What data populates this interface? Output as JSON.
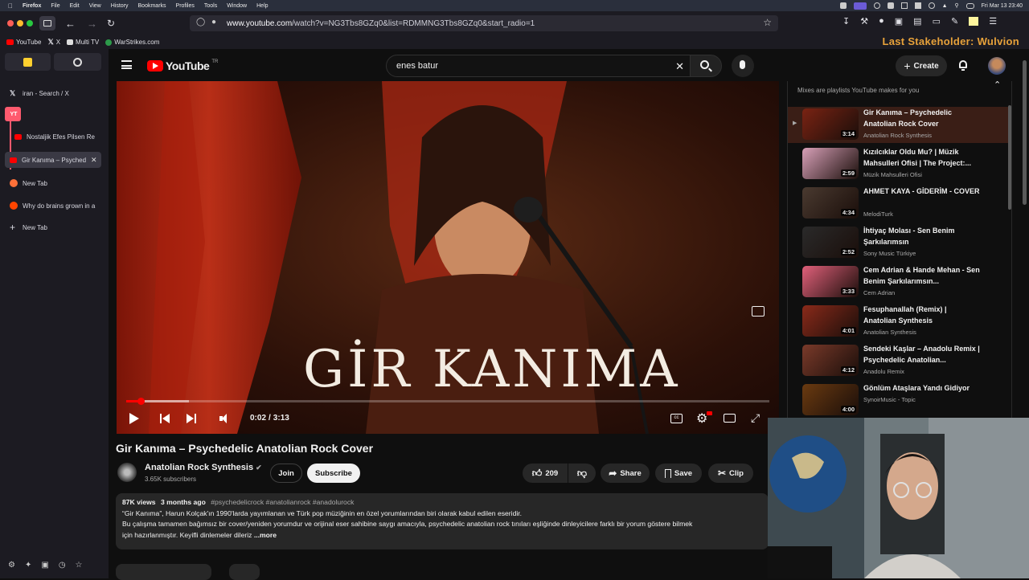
{
  "macos_menubar": {
    "app": "Firefox",
    "menus": [
      "File",
      "Edit",
      "View",
      "History",
      "Bookmarks",
      "Profiles",
      "Tools",
      "Window",
      "Help"
    ],
    "clock": "Fri Mar 13  23:40"
  },
  "browser": {
    "url_host": "www.youtube.com",
    "url_path": "/watch?v=NG3Tbs8GZq0&list=RDMMNG3Tbs8GZq0&start_radio=1",
    "bookmarks": [
      {
        "label": "YouTube",
        "icon": "youtube-icon",
        "color": "#ff0000"
      },
      {
        "label": "X",
        "icon": "x-icon",
        "color": "#ffffff"
      },
      {
        "label": "Multi TV",
        "icon": "tv-icon",
        "color": "#ffffff"
      },
      {
        "label": "WarStrikes.com",
        "icon": "globe-icon",
        "color": "#2d9a4a"
      }
    ],
    "overlay_text": "Last Stakeholder: Wulvion",
    "sidebar_tabs": [
      {
        "label": "iran - Search / X",
        "icon": "x-icon",
        "color": "#ffffff"
      },
      {
        "label": "YT",
        "icon": "yt-group-badge",
        "color": "#ff5a6e"
      },
      {
        "label": "Nostaljik Efes Pilsen Re",
        "icon": "youtube-icon",
        "color": "#ff0000"
      },
      {
        "label": "Gir Kanıma – Psyched",
        "icon": "youtube-icon",
        "color": "#ff0000",
        "active": true
      },
      {
        "label": "New Tab",
        "icon": "firefox-icon",
        "color": "#ff7139"
      },
      {
        "label": "Why do brains grown in a",
        "icon": "reddit-icon",
        "color": "#ff4500"
      },
      {
        "label": "New Tab",
        "icon": "plus-icon",
        "color": "#ffffff"
      }
    ]
  },
  "youtube": {
    "logo_text": "YouTube",
    "logo_region": "TR",
    "search_value": "enes batur",
    "create_label": "Create",
    "video": {
      "overlay_title": "GİR KANIMA",
      "time_current": "0:02",
      "time_total": "3:13",
      "progress": 0.01,
      "title": "Gir Kanıma – Psychedelic Anatolian Rock Cover",
      "channel": "Anatolian Rock Synthesis",
      "subscribers": "3.65K subscribers",
      "join_label": "Join",
      "subscribe_label": "Subscribe",
      "likes": "209",
      "share_label": "Share",
      "save_label": "Save",
      "clip_label": "Clip",
      "views": "87K views",
      "age": "3 months ago",
      "hashtags": "#psychedelicrock #anatolianrock #anadolurock",
      "desc_line1": "“Gir Kanıma”, Harun Kolçak'ın 1990'larda yayımlanan ve Türk pop müziğinin en özel yorumlarından biri olarak kabul edilen eseridir.",
      "desc_line2": "Bu çalışma tamamen bağımsız bir cover/yeniden yorumdur ve orijinal eser sahibine saygı amacıyla, psychedelic anatolian rock tınıları eşliğinde dinleyicilere farklı bir yorum göstere bilmek",
      "desc_line3": "için hazırlanmıştır. Keyifli dinlemeler dileriz",
      "more_label": "...more"
    },
    "mix_header": "Mixes are playlists YouTube makes for you",
    "playlist": [
      {
        "title": "Gir Kanıma – Psychedelic Anatolian Rock Cover",
        "channel": "Anatolian Rock Synthesis",
        "duration": "3:14",
        "color": "#7a2313",
        "active": true
      },
      {
        "title": "Kızılcıklar Oldu Mu? | Müzik Mahsulleri Ofisi | The Project:...",
        "channel": "Müzik Mahsulleri Ofisi",
        "duration": "2:59",
        "color": "#d8a0b8"
      },
      {
        "title": "AHMET KAYA - GİDERİM - COVER",
        "channel": "MelodiTurk",
        "duration": "4:34",
        "color": "#4a3a30"
      },
      {
        "title": "İhtiyaç Molası - Sen Benim Şarkılarımsın",
        "channel": "Sony Music Türkiye",
        "duration": "2:52",
        "color": "#2a2a2a"
      },
      {
        "title": "Cem Adrian & Hande Mehan - Sen Benim Şarkılarımsın...",
        "channel": "Cem Adrian",
        "duration": "3:33",
        "color": "#e0607a"
      },
      {
        "title": "Fesuphanallah (Remix) | Anatolian Synthesis",
        "channel": "Anatolian Synthesis",
        "duration": "4:01",
        "color": "#8a2a1a"
      },
      {
        "title": "Sendeki Kaşlar – Anadolu Remix | Psychedelic Anatolian...",
        "channel": "Anadolu Remix",
        "duration": "4:12",
        "color": "#7a3a2a"
      },
      {
        "title": "Gönlüm Ataşlara Yandı Gidiyor",
        "channel": "SynoirMusic - Topic",
        "duration": "4:00",
        "color": "#6a3a10"
      }
    ]
  }
}
